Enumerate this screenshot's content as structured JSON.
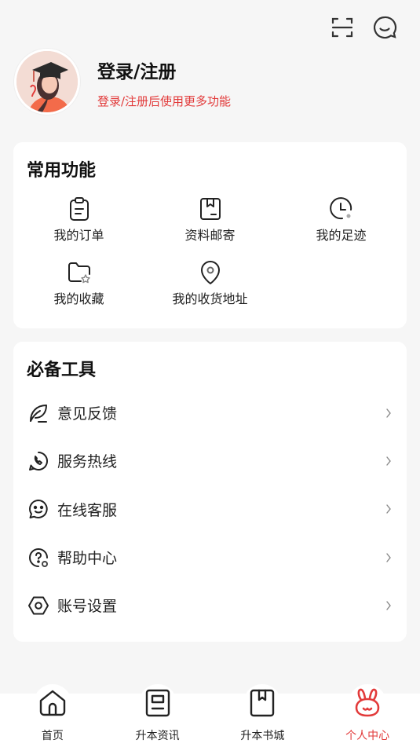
{
  "top_icons": [
    "scan-icon",
    "message-icon"
  ],
  "profile": {
    "title": "登录/注册",
    "subtitle": "登录/注册后使用更多功能"
  },
  "common_functions": {
    "title": "常用功能",
    "items": [
      {
        "label": "我的订单",
        "icon": "clipboard-icon"
      },
      {
        "label": "资料邮寄",
        "icon": "mail-book-icon"
      },
      {
        "label": "我的足迹",
        "icon": "clock-icon"
      },
      {
        "label": "我的收藏",
        "icon": "folder-star-icon"
      },
      {
        "label": "我的收货地址",
        "icon": "location-pin-icon"
      }
    ]
  },
  "tools": {
    "title": "必备工具",
    "items": [
      {
        "label": "意见反馈",
        "icon": "leaf-pen-icon"
      },
      {
        "label": "服务热线",
        "icon": "phone-icon"
      },
      {
        "label": "在线客服",
        "icon": "smile-chat-icon"
      },
      {
        "label": "帮助中心",
        "icon": "help-icon"
      },
      {
        "label": "账号设置",
        "icon": "settings-hex-icon"
      }
    ]
  },
  "bottom_nav": {
    "items": [
      {
        "label": "首页",
        "icon": "home-icon",
        "active": false
      },
      {
        "label": "升本资讯",
        "icon": "news-icon",
        "active": false
      },
      {
        "label": "升本书城",
        "icon": "book-icon",
        "active": false
      },
      {
        "label": "个人中心",
        "icon": "rabbit-icon",
        "active": true
      }
    ]
  },
  "colors": {
    "accent": "#e23a3a",
    "background": "#f6f6f6",
    "card": "#ffffff"
  }
}
